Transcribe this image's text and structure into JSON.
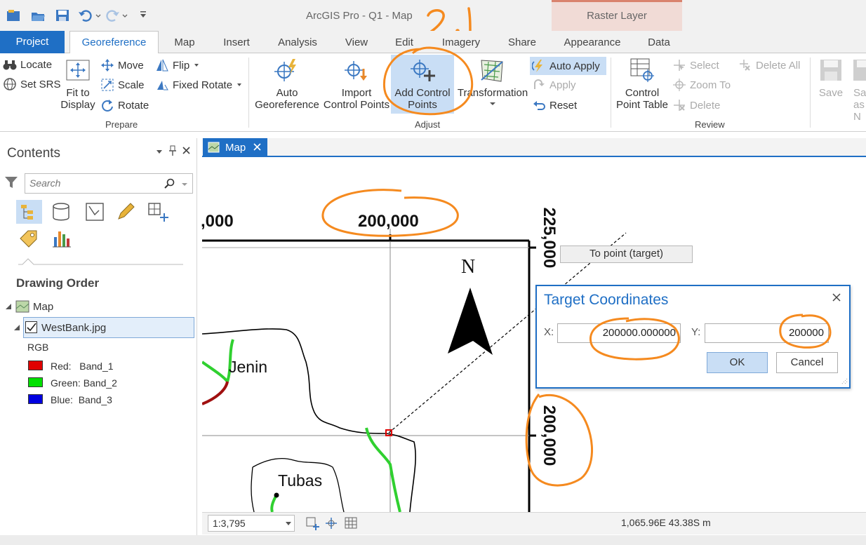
{
  "window": {
    "title": "ArcGIS Pro - Q1 - Map",
    "contextual_group": "Raster Layer"
  },
  "annotations": {
    "step_label": "2.1"
  },
  "ribbon": {
    "tabs": {
      "project": "Project",
      "georeference": "Georeference",
      "map": "Map",
      "insert": "Insert",
      "analysis": "Analysis",
      "view": "View",
      "edit": "Edit",
      "imagery": "Imagery",
      "share": "Share",
      "appearance": "Appearance",
      "data": "Data"
    },
    "prepare": {
      "group_label": "Prepare",
      "locate": "Locate",
      "set_srs": "Set SRS",
      "fit_line1": "Fit to",
      "fit_line2": "Display",
      "move": "Move",
      "scale": "Scale",
      "rotate": "Rotate",
      "flip": "Flip",
      "fixed_rotate": "Fixed Rotate"
    },
    "adjust": {
      "group_label": "Adjust",
      "auto_line1": "Auto",
      "auto_line2": "Georeference",
      "import_line1": "Import",
      "import_line2": "Control Points",
      "add_line1": "Add Control",
      "add_line2": "Points",
      "transformation": "Transformation",
      "auto_apply": "Auto Apply",
      "apply": "Apply",
      "reset": "Reset"
    },
    "review": {
      "group_label": "Review",
      "cpt_line1": "Control",
      "cpt_line2": "Point Table",
      "select": "Select",
      "zoom_to": "Zoom To",
      "delete": "Delete",
      "delete_all": "Delete All"
    },
    "save": {
      "save": "Save",
      "save_as_line1": "Sa",
      "save_as_line2": "as N"
    }
  },
  "contents": {
    "title": "Contents",
    "search_placeholder": "Search",
    "section": "Drawing Order",
    "map_layer": "Map",
    "raster_layer": "WestBank.jpg",
    "render_type": "RGB",
    "bands": [
      {
        "label": "Red:   Band_1",
        "color": "#e00000"
      },
      {
        "label": "Green: Band_2",
        "color": "#00e000"
      },
      {
        "label": "Blue:  Band_3",
        "color": "#0000e0"
      }
    ]
  },
  "map_view": {
    "tab_label": "Map",
    "grid_labels": {
      "x_left": ",000",
      "x_center": "200,000",
      "y_top": "225,000",
      "y_mid": "200,000"
    },
    "north_label": "N",
    "places": [
      "Jenin",
      "Tubas"
    ],
    "tooltip": "To point (target)"
  },
  "dialog": {
    "title": "Target Coordinates",
    "x_label": "X:",
    "x_value": "200000.000000",
    "y_label": "Y:",
    "y_value": "200000",
    "ok": "OK",
    "cancel": "Cancel"
  },
  "statusbar": {
    "scale": "1:3,795",
    "coordinates": "1,065.96E 43.38S m"
  },
  "colors": {
    "accent": "#1f6fc5",
    "annotation": "#f58a1f",
    "contextual": "#f1dbd6"
  }
}
